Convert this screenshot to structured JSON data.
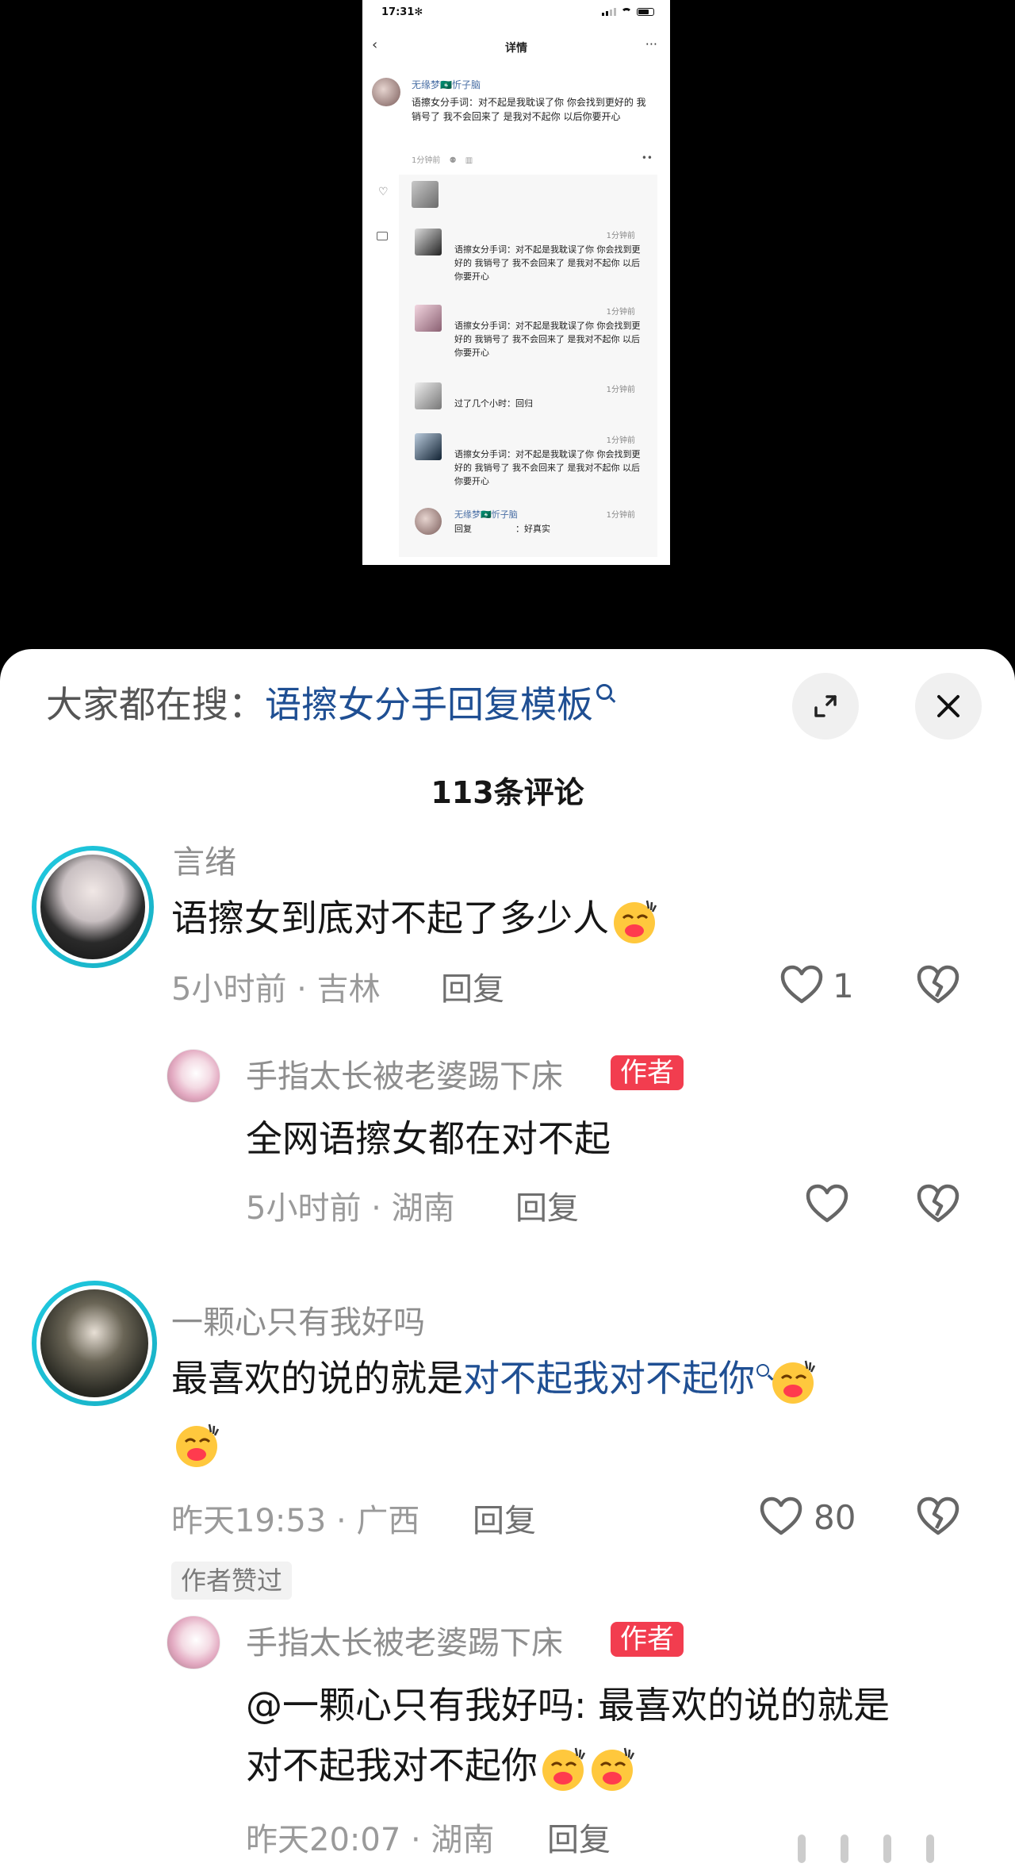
{
  "screenshot": {
    "status_time": "17:31✻",
    "nav_title": "详情",
    "post": {
      "author": "无缘梦🇲🇴忻子脑",
      "text": "语擦女分手词：对不起是我耽误了你 你会找到更好的 我销号了 我不会回来了 是我对不起你 以后你要开心",
      "time": "1分钟前"
    },
    "replies": [
      {
        "time": "1分钟前",
        "text": "语擦女分手词：对不起是我耽误了你 你会找到更好的 我销号了 我不会回来了 是我对不起你 以后你要开心"
      },
      {
        "time": "1分钟前",
        "text": "语擦女分手词：对不起是我耽误了你 你会找到更好的 我销号了 我不会回来了 是我对不起你 以后你要开心"
      },
      {
        "time": "1分钟前",
        "text": "过了几个小时：回归"
      },
      {
        "time": "1分钟前",
        "text": "语擦女分手词：对不起是我耽误了你 你会找到更好的 我销号了 我不会回来了 是我对不起你 以后你要开心"
      },
      {
        "time": "1分钟前",
        "name": "无缘梦🇲🇴忻子脑",
        "text": "回复　　　　　：好真实"
      }
    ]
  },
  "sheet": {
    "search_label": "大家都在搜：",
    "search_term": "语擦女分手回复模板",
    "title": "113条评论"
  },
  "comments": [
    {
      "username": "言绪",
      "text": "语擦女到底对不起了多少人",
      "meta": "5小时前 · 吉林",
      "reply": "回复",
      "likes": "1"
    },
    {
      "username": "手指太长被老婆踢下床",
      "badge": "作者",
      "text": "全网语擦女都在对不起",
      "meta": "5小时前 · 湖南",
      "reply": "回复"
    },
    {
      "username": "一颗心只有我好吗",
      "text_before": "最喜欢的说的就是",
      "text_link": "对不起我对不起你",
      "meta": "昨天19:53 · 广西",
      "reply": "回复",
      "likes": "80",
      "tag": "作者赞过"
    },
    {
      "username": "手指太长被老婆踢下床",
      "badge": "作者",
      "text_line1": "@一颗心只有我好吗: 最喜欢的说的就是",
      "text_line2": "对不起我对不起你",
      "meta": "昨天20:07 · 湖南",
      "reply": "回复"
    }
  ],
  "colors": {
    "link": "#1f4f93",
    "badge": "#f23d4f",
    "ring": "#20c9e0"
  }
}
